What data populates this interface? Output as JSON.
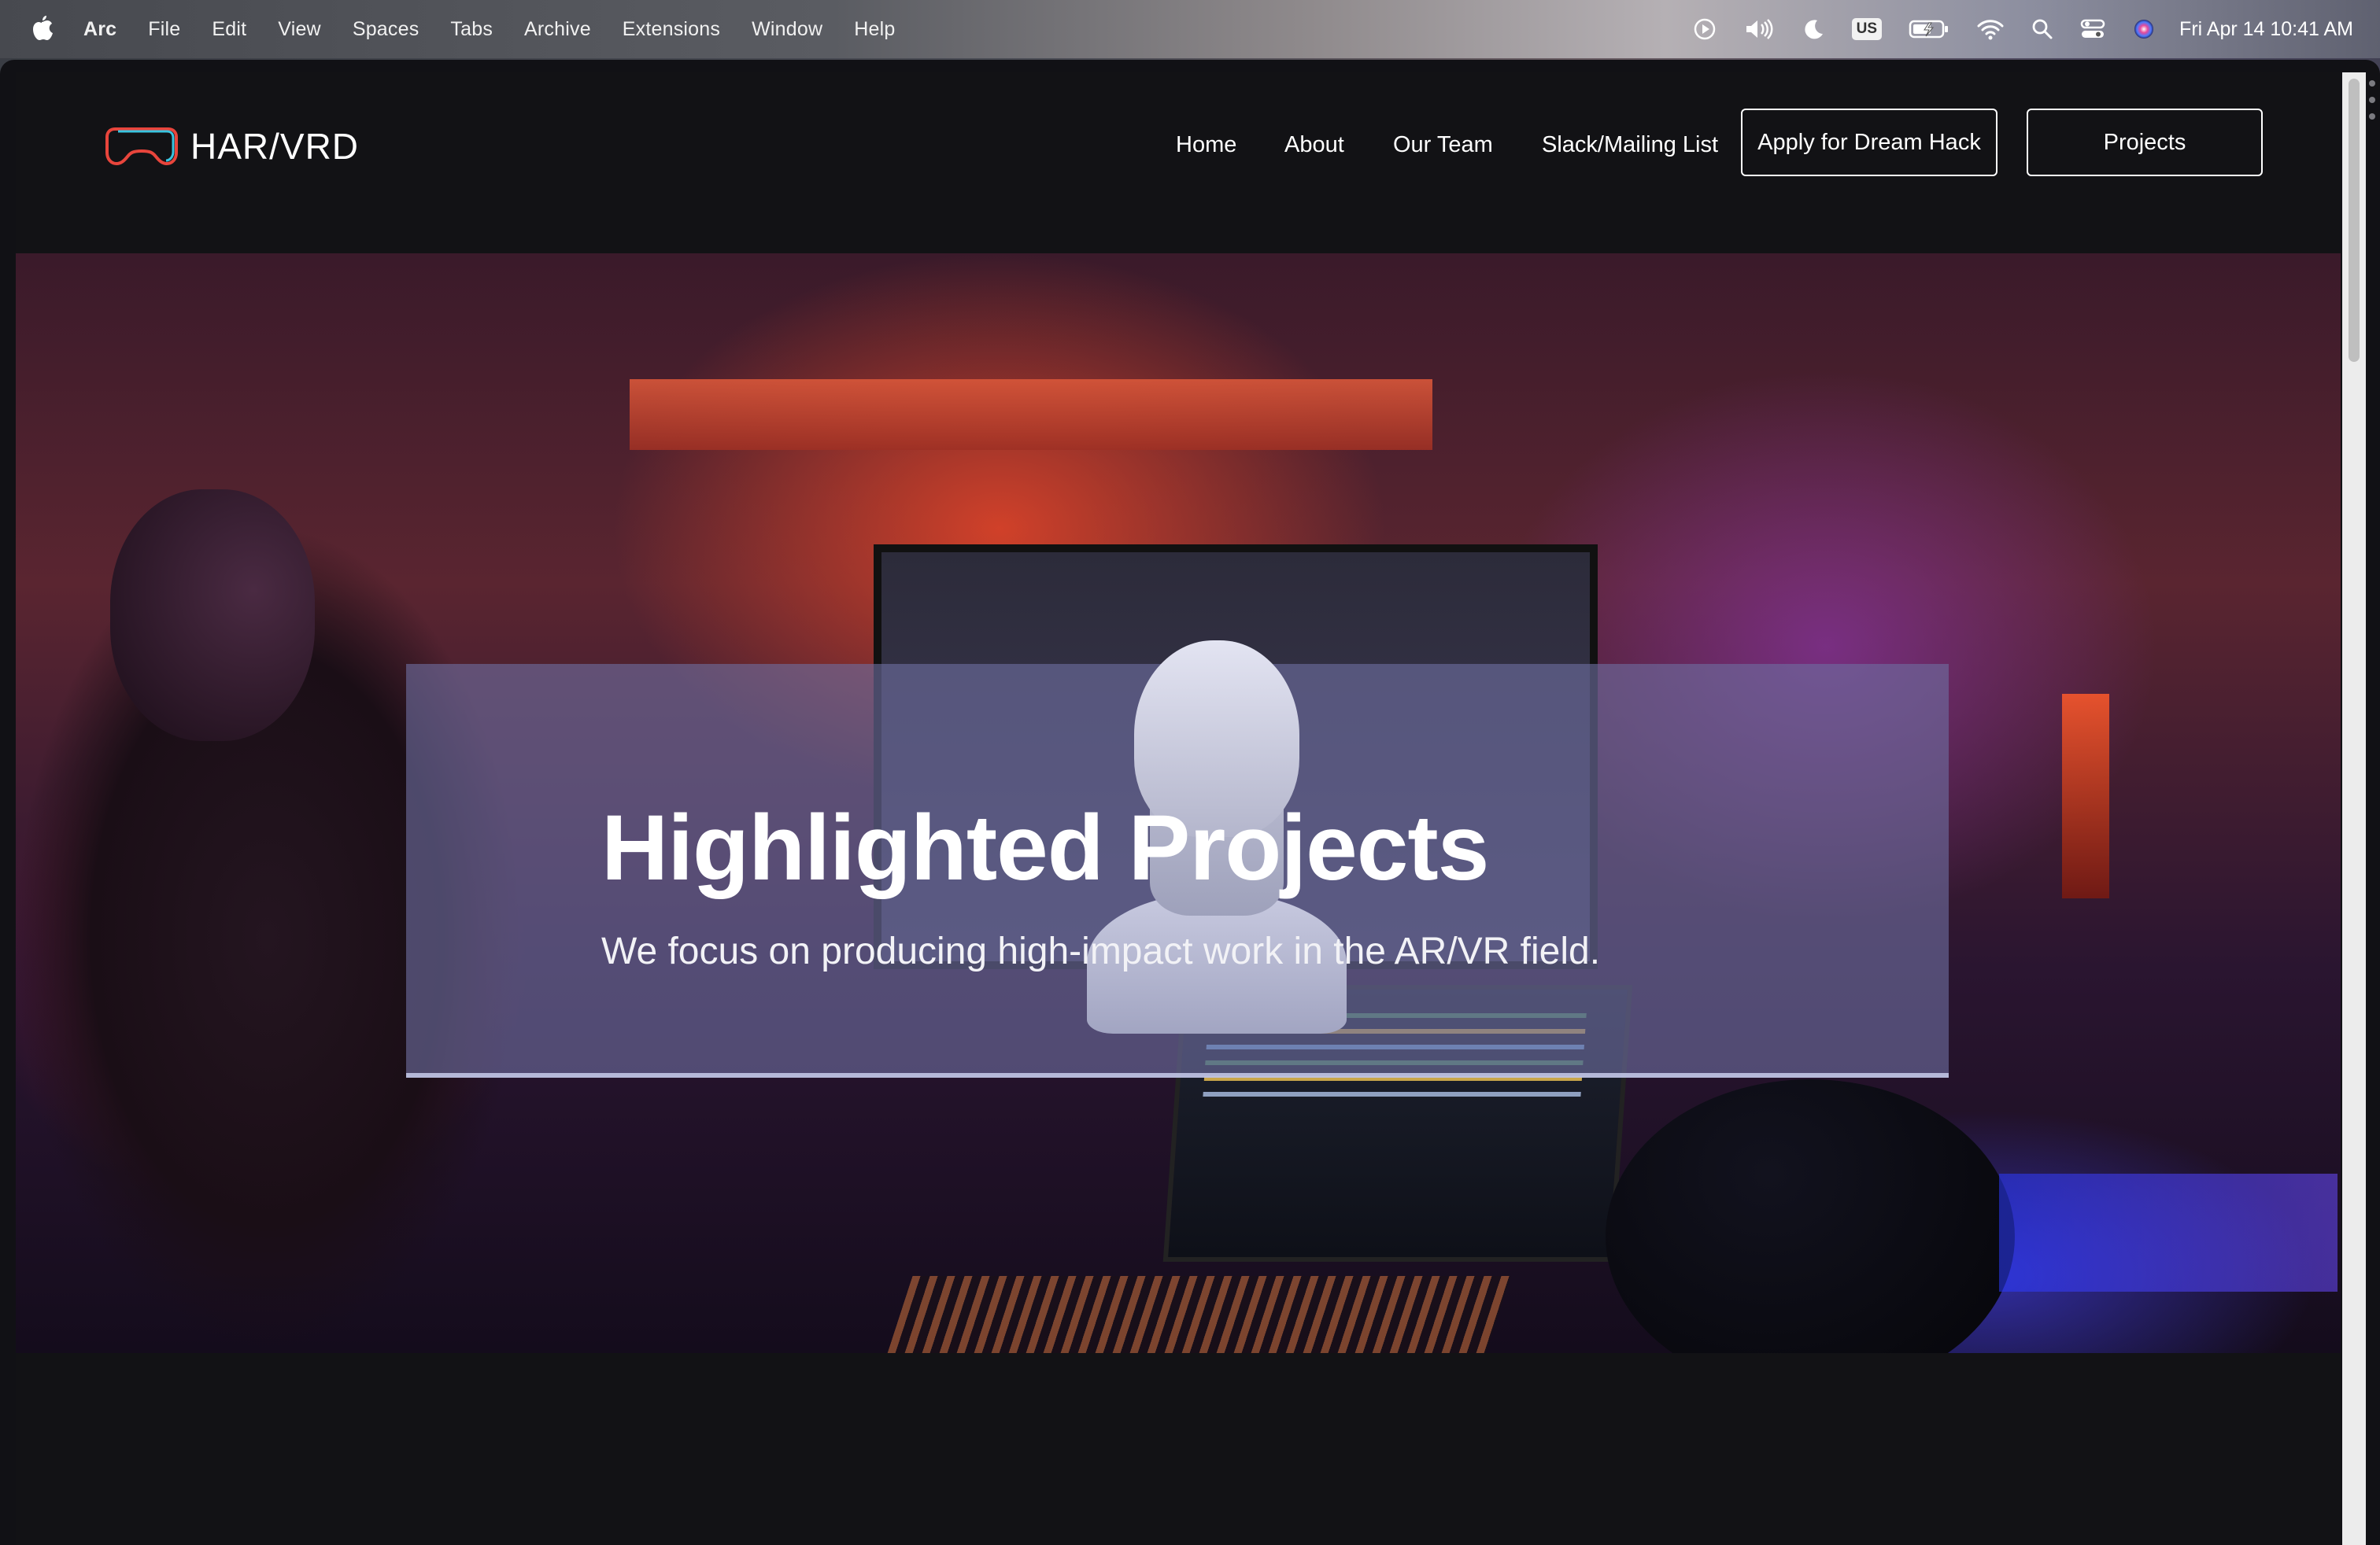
{
  "menubar": {
    "app_name": "Arc",
    "items": [
      "File",
      "Edit",
      "View",
      "Spaces",
      "Tabs",
      "Archive",
      "Extensions",
      "Window",
      "Help"
    ],
    "keyboard_layout": "US",
    "datetime": "Fri Apr 14  10:41 AM",
    "icons": [
      "apple-icon",
      "play-icon",
      "volume-icon",
      "moon-icon",
      "keyboard-icon",
      "battery-icon",
      "wifi-icon",
      "search-icon",
      "control-center-icon",
      "siri-icon"
    ]
  },
  "site": {
    "logo_text": "HAR/VRD",
    "nav": {
      "home": "Home",
      "about": "About",
      "team": "Our Team",
      "slack": "Slack/Mailing List",
      "apply": "Apply for Dream Hack",
      "projects": "Projects"
    },
    "hero": {
      "title": "Highlighted Projects",
      "subtitle": "We focus on producing high-impact work in the AR/VR field."
    }
  },
  "colors": {
    "page_bg": "#121215",
    "text": "#ffffff",
    "card_overlay": "#6e6ea0",
    "accent_red": "#d9573a",
    "accent_purple": "#82329a"
  }
}
